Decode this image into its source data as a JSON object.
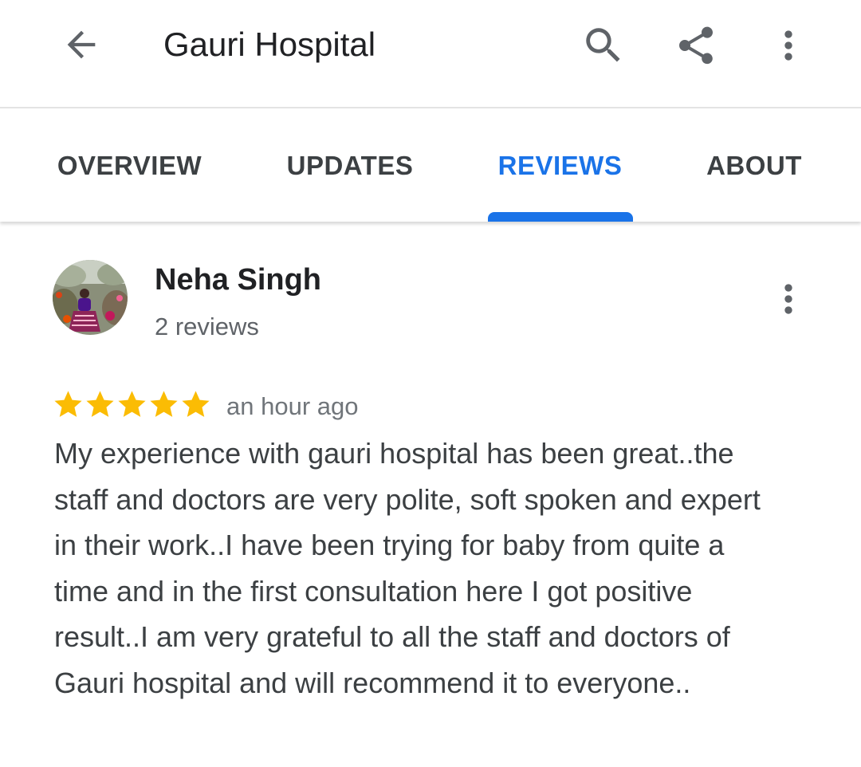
{
  "header": {
    "title": "Gauri Hospital",
    "icons": {
      "back": "arrow-back-icon",
      "search": "search-icon",
      "share": "share-icon",
      "more": "more-vert-icon"
    }
  },
  "tabs": [
    {
      "label": "OVERVIEW",
      "active": false
    },
    {
      "label": "UPDATES",
      "active": false
    },
    {
      "label": "REVIEWS",
      "active": true
    },
    {
      "label": "ABOUT",
      "active": false
    }
  ],
  "review": {
    "author": "Neha Singh",
    "author_meta": "2 reviews",
    "rating": 5,
    "rating_max": 5,
    "time": "an hour ago",
    "text": "My experience with gauri hospital has been great..the staff and doctors are very polite, soft spoken and expert in their work..I have been trying for baby from quite a time and in the first consultation here I got positive result..I am very grateful to all the staff and doctors of Gauri hospital and will recommend it to everyone.."
  },
  "colors": {
    "accent": "#1a73e8",
    "star": "#fbbc04",
    "text_primary": "#202124",
    "text_secondary": "#5f6368",
    "icon": "#5f6368"
  }
}
